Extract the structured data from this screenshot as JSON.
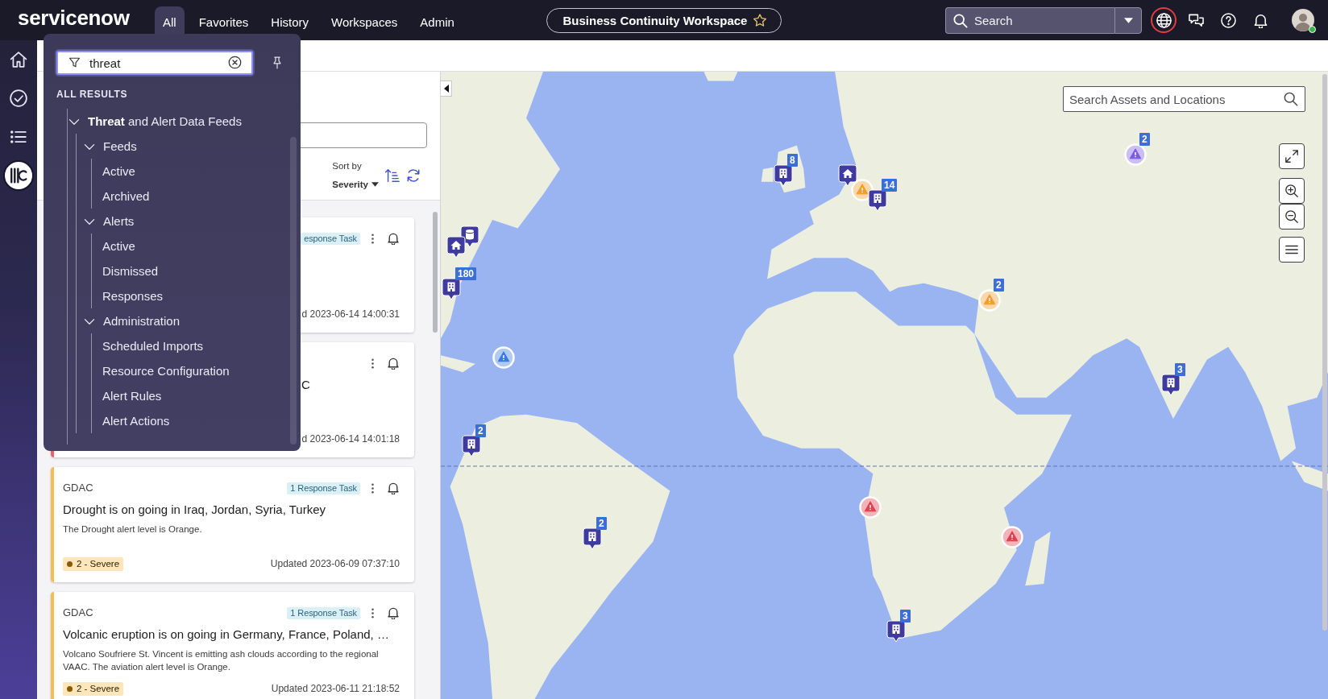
{
  "header": {
    "logo": "servicenow",
    "nav": [
      {
        "label": "All",
        "selected": true
      },
      {
        "label": "Favorites",
        "selected": false
      },
      {
        "label": "History",
        "selected": false
      },
      {
        "label": "Workspaces",
        "selected": false
      },
      {
        "label": "Admin",
        "selected": false
      }
    ],
    "workspace": {
      "title": "Business Continuity Workspace",
      "favorite": false
    },
    "search": {
      "placeholder": "Search"
    },
    "icons": [
      {
        "kind": "globe",
        "highlighted": true
      },
      {
        "kind": "chat",
        "highlighted": false
      },
      {
        "kind": "help",
        "highlighted": false
      },
      {
        "kind": "bell",
        "highlighted": false
      }
    ],
    "avatar": {
      "online": true
    }
  },
  "sidebar": {
    "items": [
      {
        "kind": "home",
        "selected": false
      },
      {
        "kind": "check",
        "selected": false
      },
      {
        "kind": "list",
        "selected": false
      },
      {
        "kind": "workspace",
        "selected": true
      }
    ]
  },
  "nav_menu": {
    "filter": {
      "value": "threat"
    },
    "section_label": "ALL RESULTS",
    "results": [
      {
        "label": "**Threat** and Alert Data Feeds",
        "expanded": true,
        "children": [
          {
            "label": "Feeds",
            "expanded": true,
            "children": [
              {
                "label": "Active"
              },
              {
                "label": "Archived"
              }
            ]
          },
          {
            "label": "Alerts",
            "expanded": true,
            "children": [
              {
                "label": "Active"
              },
              {
                "label": "Dismissed"
              },
              {
                "label": "Responses"
              }
            ]
          },
          {
            "label": "Administration",
            "expanded": true,
            "children": [
              {
                "label": "Scheduled Imports"
              },
              {
                "label": "Resource Configuration"
              },
              {
                "label": "Alert Rules"
              },
              {
                "label": "Alert Actions"
              }
            ]
          }
        ]
      }
    ]
  },
  "alert_list": {
    "sort": {
      "label": "Sort by",
      "value": "Severity"
    },
    "alerts": [
      {
        "badge": "esponse Task",
        "updated": "d 2023-06-14 14:00:31"
      },
      {
        "color": "#e4646f",
        "title": "C",
        "updated": "d 2023-06-14 14:01:18"
      },
      {
        "color": "#f2bd55",
        "source": "GDAC",
        "badge": "1 Response Task",
        "title": "Drought is on going in Iraq, Jordan, Syria, Turkey",
        "description": "The Drought alert level is Orange.",
        "severity": "2 - Severe",
        "updated": "Updated 2023-06-09 07:37:10"
      },
      {
        "color": "#f2bd55",
        "source": "GDAC",
        "badge": "1 Response Task",
        "title": "Volcanic eruption is on going in Germany, France, Poland, …",
        "description": "Volcano Soufriere St. Vincent is emitting ash clouds according to the regional VAAC. The aviation alert level is Orange.",
        "severity": "2 - Severe",
        "updated": "Updated 2023-06-11 21:18:52"
      }
    ]
  },
  "map": {
    "search": {
      "placeholder": "Search Assets and Locations"
    },
    "markers": [
      {
        "kind": "alert",
        "color": "#7c5ce6",
        "count": "2"
      },
      {
        "kind": "building",
        "count": "8"
      },
      {
        "kind": "home"
      },
      {
        "kind": "alert",
        "color": "#f29d2e"
      },
      {
        "kind": "building",
        "count": "14"
      },
      {
        "kind": "database"
      },
      {
        "kind": "home"
      },
      {
        "kind": "building",
        "count": "180"
      },
      {
        "kind": "alert",
        "color": "#f29d2e",
        "count": "2"
      },
      {
        "kind": "alert",
        "color": "#3a7be0"
      },
      {
        "kind": "building",
        "count": "3"
      },
      {
        "kind": "building",
        "count": "2"
      },
      {
        "kind": "alert",
        "color": "#e2414f"
      },
      {
        "kind": "alert",
        "color": "#e2414f"
      },
      {
        "kind": "building",
        "count": "2"
      },
      {
        "kind": "building",
        "count": "3"
      }
    ]
  }
}
